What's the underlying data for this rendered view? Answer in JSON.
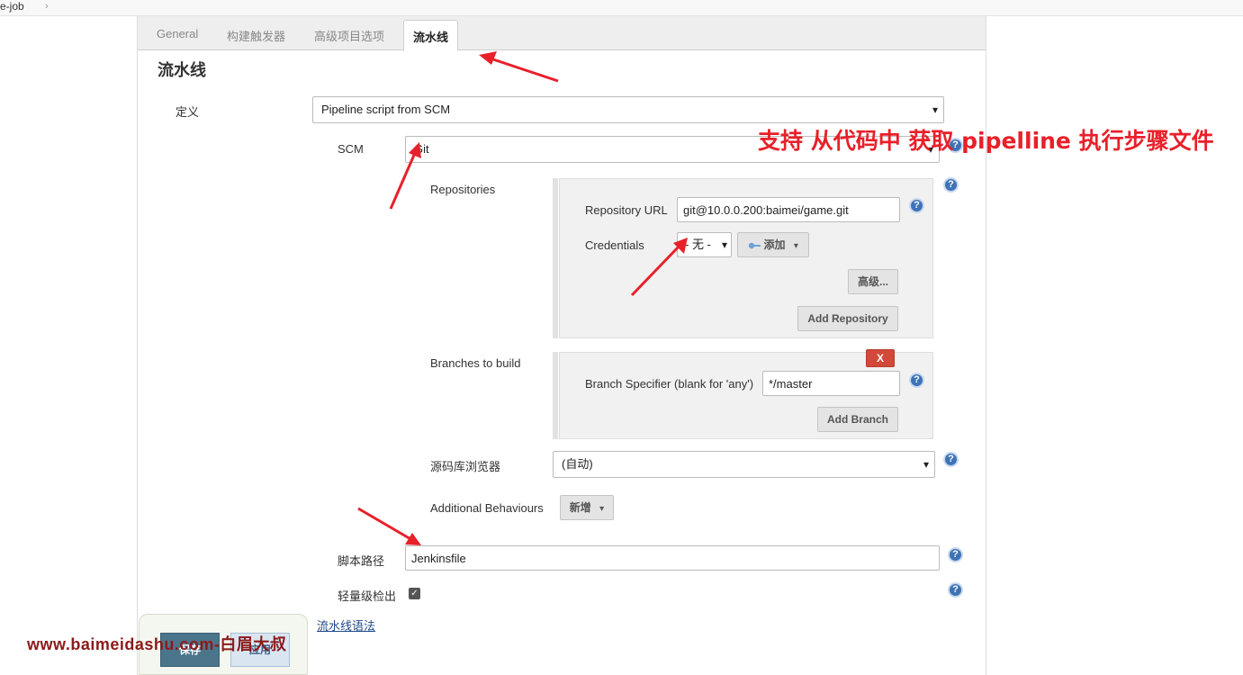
{
  "breadcrumb": {
    "job": "e-job",
    "separator": "›"
  },
  "tabs": [
    {
      "label": "General"
    },
    {
      "label": "构建触发器"
    },
    {
      "label": "高级项目选项"
    },
    {
      "label": "流水线"
    }
  ],
  "section_title": "流水线",
  "definition": {
    "label": "定义",
    "value": "Pipeline script from SCM"
  },
  "scm": {
    "label": "SCM",
    "value": "Git"
  },
  "repositories": {
    "label": "Repositories",
    "url_label": "Repository URL",
    "url_value": "git@10.0.0.200:baimei/game.git",
    "credentials_label": "Credentials",
    "credentials_value": "- 无 -",
    "add_label": "添加",
    "advanced_label": "高级...",
    "add_repository_label": "Add Repository"
  },
  "branches": {
    "label": "Branches to build",
    "delete_label": "X",
    "specifier_label": "Branch Specifier (blank for 'any')",
    "specifier_value": "*/master",
    "add_branch_label": "Add Branch"
  },
  "browser": {
    "label": "源码库浏览器",
    "value": "(自动)"
  },
  "behaviours": {
    "label": "Additional Behaviours",
    "add_label": "新增"
  },
  "script_path": {
    "label": "脚本路径",
    "value": "Jenkinsfile"
  },
  "lightweight": {
    "label": "轻量级检出",
    "checked": true
  },
  "pipeline_syntax_link": "流水线语法",
  "buttons": {
    "save": "保存",
    "apply": "应用"
  },
  "watermark": "www.baimeidashu.com-白眉大叔",
  "annotation": "支持 从代码中 获取  pipelline 执行步骤文件",
  "help_glyph": "?",
  "check_glyph": "✓",
  "caret_glyph": "▾",
  "colors": {
    "annotation": "#e8202a",
    "watermark": "#8b1a1a",
    "help": "#3f73b6",
    "delete": "#d24939"
  }
}
